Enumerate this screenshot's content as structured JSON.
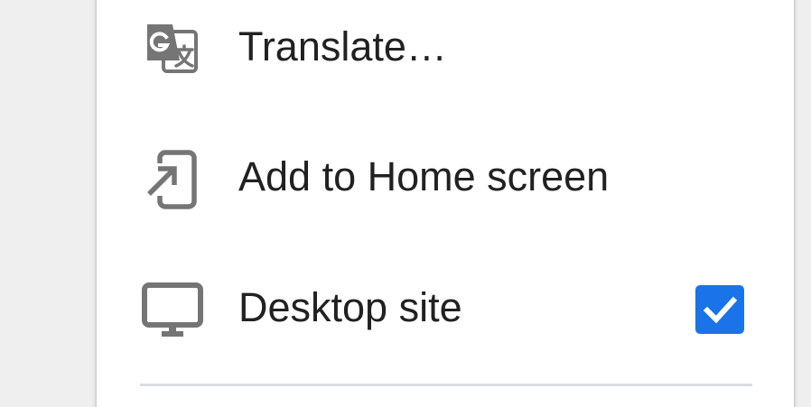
{
  "menu": {
    "items": [
      {
        "label": "Translate…",
        "icon": "translate-icon"
      },
      {
        "label": "Add to Home screen",
        "icon": "add-to-home-screen-icon"
      },
      {
        "label": "Desktop site",
        "icon": "desktop-icon",
        "checked": true
      }
    ]
  },
  "colors": {
    "icon": "#757575",
    "text": "#212121",
    "checkbox": "#1a73e8",
    "divider": "#dadce0",
    "background": "#efefef",
    "menu_background": "#ffffff"
  }
}
